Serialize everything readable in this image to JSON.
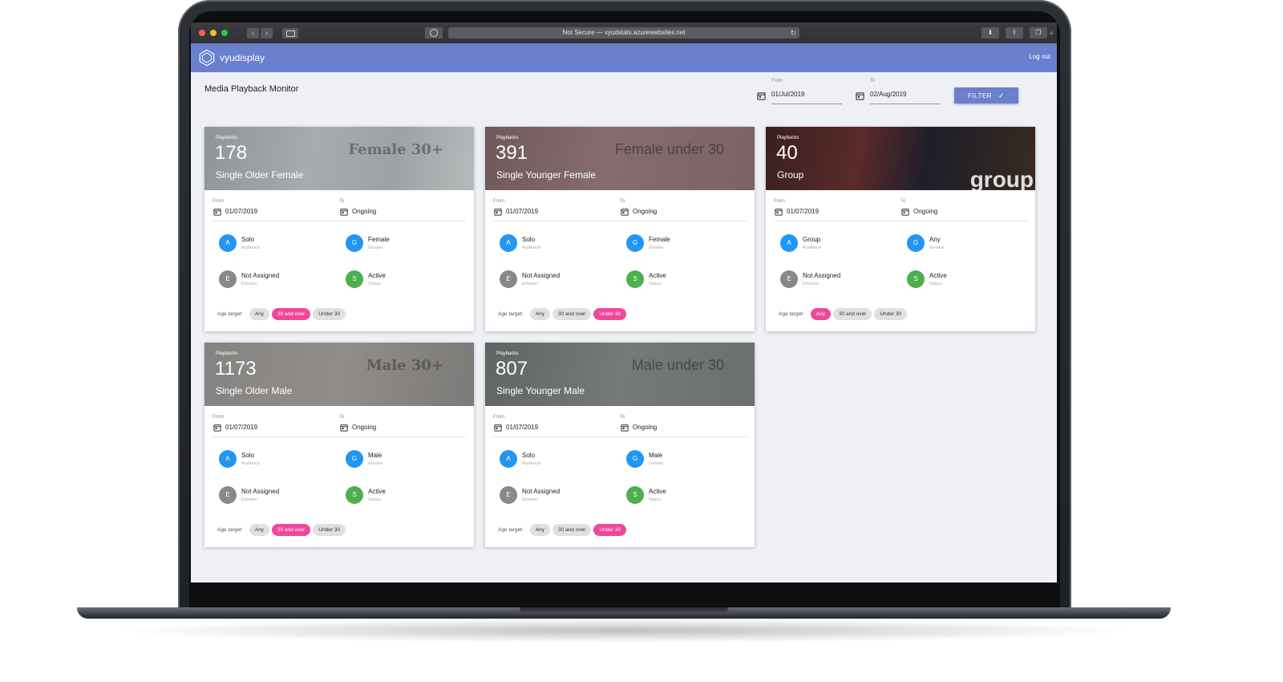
{
  "browser": {
    "url": "Not Secure — vyudstats.azurewebsites.net"
  },
  "app": {
    "brand": "vyudisplay",
    "logout": "Log out",
    "page_title": "Media Playback Monitor"
  },
  "filter": {
    "from_label": "From",
    "from_value": "01/Jul/2019",
    "to_label": "To",
    "to_value": "02/Aug/2019",
    "button_label": "FILTER"
  },
  "colors": {
    "header": "#6b7fcf",
    "chip_selected": "#f0479a",
    "avatar_blue": "#2196f3",
    "avatar_grey": "#888888",
    "avatar_green": "#4caf50"
  },
  "cards": [
    {
      "playbacks_label": "Playbacks",
      "count": "178",
      "title": "Single Older Female",
      "banner_text": "Female 30+",
      "hero_color": "#8a8f93",
      "from_label": "From",
      "from_value": "01/07/2019",
      "to_label": "To",
      "to_value": "Ongoing",
      "audience": {
        "letter": "A",
        "value": "Solo",
        "label": "Audience"
      },
      "gender": {
        "letter": "G",
        "value": "Female",
        "label": "Gender"
      },
      "emotion": {
        "letter": "E",
        "value": "Not Assigned",
        "label": "Emotion"
      },
      "status": {
        "letter": "S",
        "value": "Active",
        "label": "Status"
      },
      "age_label": "Age target:",
      "age_chips": [
        "Any",
        "30 and over",
        "Under 30"
      ],
      "age_selected": "30 and over"
    },
    {
      "playbacks_label": "Playbacks",
      "count": "391",
      "title": "Single Younger Female",
      "banner_text": "Female under 30",
      "hero_color": "#7d6468",
      "from_label": "From",
      "from_value": "01/07/2019",
      "to_label": "To",
      "to_value": "Ongoing",
      "audience": {
        "letter": "A",
        "value": "Solo",
        "label": "Audience"
      },
      "gender": {
        "letter": "G",
        "value": "Female",
        "label": "Gender"
      },
      "emotion": {
        "letter": "E",
        "value": "Not Assigned",
        "label": "Emotion"
      },
      "status": {
        "letter": "S",
        "value": "Active",
        "label": "Status"
      },
      "age_label": "Age target:",
      "age_chips": [
        "Any",
        "30 and over",
        "Under 30"
      ],
      "age_selected": "Under 30"
    },
    {
      "playbacks_label": "Playbacks",
      "count": "40",
      "title": "Group",
      "banner_text": "group",
      "hero_color": "#2a1d1e",
      "from_label": "From",
      "from_value": "01/07/2019",
      "to_label": "To",
      "to_value": "Ongoing",
      "audience": {
        "letter": "A",
        "value": "Group",
        "label": "Audience"
      },
      "gender": {
        "letter": "G",
        "value": "Any",
        "label": "Gender"
      },
      "emotion": {
        "letter": "E",
        "value": "Not Assigned",
        "label": "Emotion"
      },
      "status": {
        "letter": "S",
        "value": "Active",
        "label": "Status"
      },
      "age_label": "Age target:",
      "age_chips": [
        "Any",
        "30 and over",
        "Under 30"
      ],
      "age_selected": "Any"
    },
    {
      "playbacks_label": "Playbacks",
      "count": "1173",
      "title": "Single Older Male",
      "banner_text": "Male 30+",
      "hero_color": "#7e7c7a",
      "from_label": "From",
      "from_value": "01/07/2019",
      "to_label": "To",
      "to_value": "Ongoing",
      "audience": {
        "letter": "A",
        "value": "Solo",
        "label": "Audience"
      },
      "gender": {
        "letter": "G",
        "value": "Male",
        "label": "Gender"
      },
      "emotion": {
        "letter": "E",
        "value": "Not Assigned",
        "label": "Emotion"
      },
      "status": {
        "letter": "S",
        "value": "Active",
        "label": "Status"
      },
      "age_label": "Age target:",
      "age_chips": [
        "Any",
        "30 and over",
        "Under 30"
      ],
      "age_selected": "30 and over"
    },
    {
      "playbacks_label": "Playbacks",
      "count": "807",
      "title": "Single Younger Male",
      "banner_text": "Male under 30",
      "hero_color": "#6f7572",
      "from_label": "From",
      "from_value": "01/07/2019",
      "to_label": "To",
      "to_value": "Ongoing",
      "audience": {
        "letter": "A",
        "value": "Solo",
        "label": "Audience"
      },
      "gender": {
        "letter": "G",
        "value": "Male",
        "label": "Gender"
      },
      "emotion": {
        "letter": "E",
        "value": "Not Assigned",
        "label": "Emotion"
      },
      "status": {
        "letter": "S",
        "value": "Active",
        "label": "Status"
      },
      "age_label": "Age target:",
      "age_chips": [
        "Any",
        "30 and over",
        "Under 30"
      ],
      "age_selected": "Under 30"
    }
  ]
}
